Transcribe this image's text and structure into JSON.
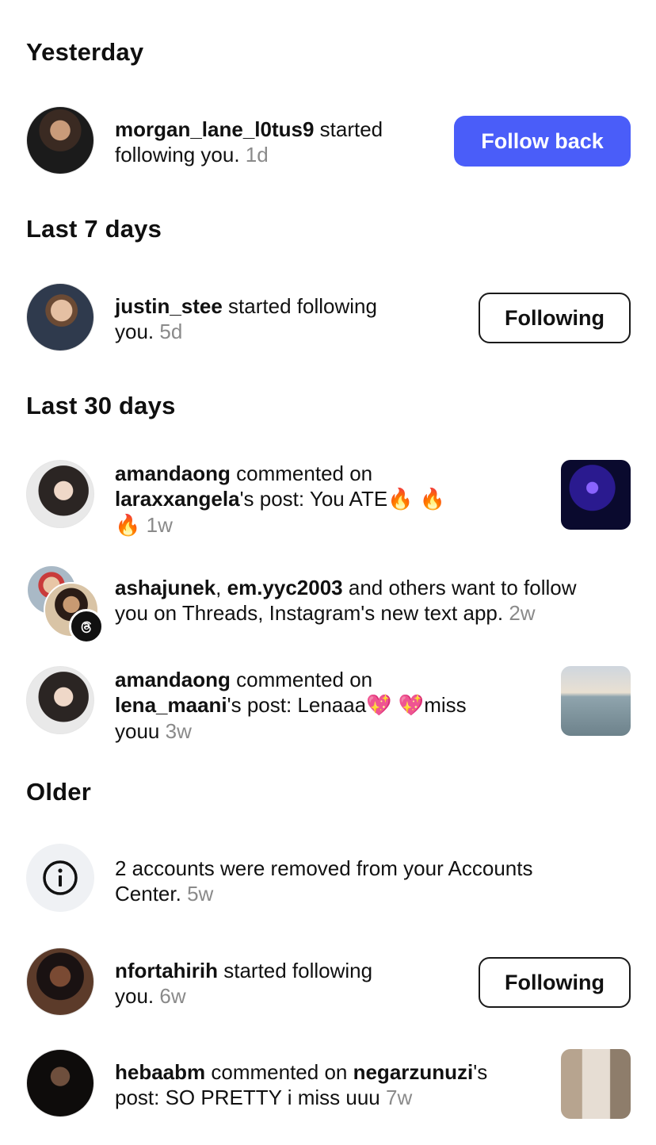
{
  "sections": {
    "yesterday": "Yesterday",
    "last7": "Last 7 days",
    "last30": "Last 30 days",
    "older": "Older"
  },
  "notifications": [
    {
      "user": "morgan_lane_l0tus9",
      "text1": " started",
      "text2": "following you.",
      "time": "1d",
      "button": "Follow back"
    },
    {
      "user": "justin_stee",
      "text1": " started following",
      "text2": "you.",
      "time": "5d",
      "button": "Following"
    },
    {
      "user": "amandaong",
      "text1": " commented on",
      "user2": "laraxxangela",
      "text2": "'s post: You ATE",
      "emoji1": "🔥 🔥",
      "emoji2": "🔥",
      "time": "1w"
    },
    {
      "user": "ashajunek",
      "sep": ", ",
      "user2": "em.yyc2003",
      "text1": " and others want to follow",
      "text2": "you on Threads, Instagram's new text app.",
      "time": "2w"
    },
    {
      "user": "amandaong",
      "text1": " commented on",
      "user2": "lena_maani",
      "text2": "'s post: Lenaaa",
      "emoji1": "💖 💖",
      "text3": "miss",
      "text4": "youu",
      "time": "3w"
    },
    {
      "text1": "2 accounts were removed from your Accounts",
      "text2": "Center.",
      "time": "5w"
    },
    {
      "user": "nfortahirih",
      "text1": " started following",
      "text2": "you.",
      "time": "6w",
      "button": "Following"
    },
    {
      "user": "hebaabm",
      "text1": " commented on ",
      "user2": "negarzunuzi",
      "text2": "'s",
      "text3": "post: SO PRETTY i miss uuu",
      "time": "7w"
    }
  ],
  "icons": {
    "info": "info-icon",
    "threads": "threads-icon"
  },
  "colors": {
    "primary": "#4a5df9",
    "muted": "#8a8a8a"
  }
}
